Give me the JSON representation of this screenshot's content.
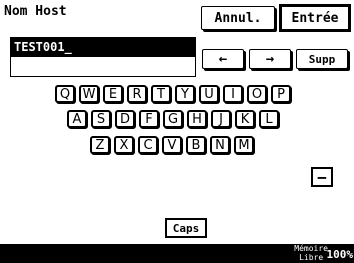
{
  "header": {
    "title": "Nom Host",
    "cancel_label": "Annul.",
    "enter_label": "Entrée"
  },
  "input": {
    "value": "TEST001_"
  },
  "controls": {
    "left_arrow": "←",
    "right_arrow": "→",
    "delete_label": "Supp",
    "minus_label": "−",
    "caps_label": "Caps"
  },
  "keyboard": {
    "row1": [
      "Q",
      "W",
      "E",
      "R",
      "T",
      "Y",
      "U",
      "I",
      "O",
      "P"
    ],
    "row2": [
      "A",
      "S",
      "D",
      "F",
      "G",
      "H",
      "J",
      "K",
      "L"
    ],
    "row3": [
      "Z",
      "X",
      "C",
      "V",
      "B",
      "N",
      "M"
    ]
  },
  "footer": {
    "memory_label": "Mémoire",
    "free_label": "Libre",
    "memory_value": "100%"
  },
  "icons": {
    "left": "arrow-left-icon",
    "right": "arrow-right-icon"
  }
}
